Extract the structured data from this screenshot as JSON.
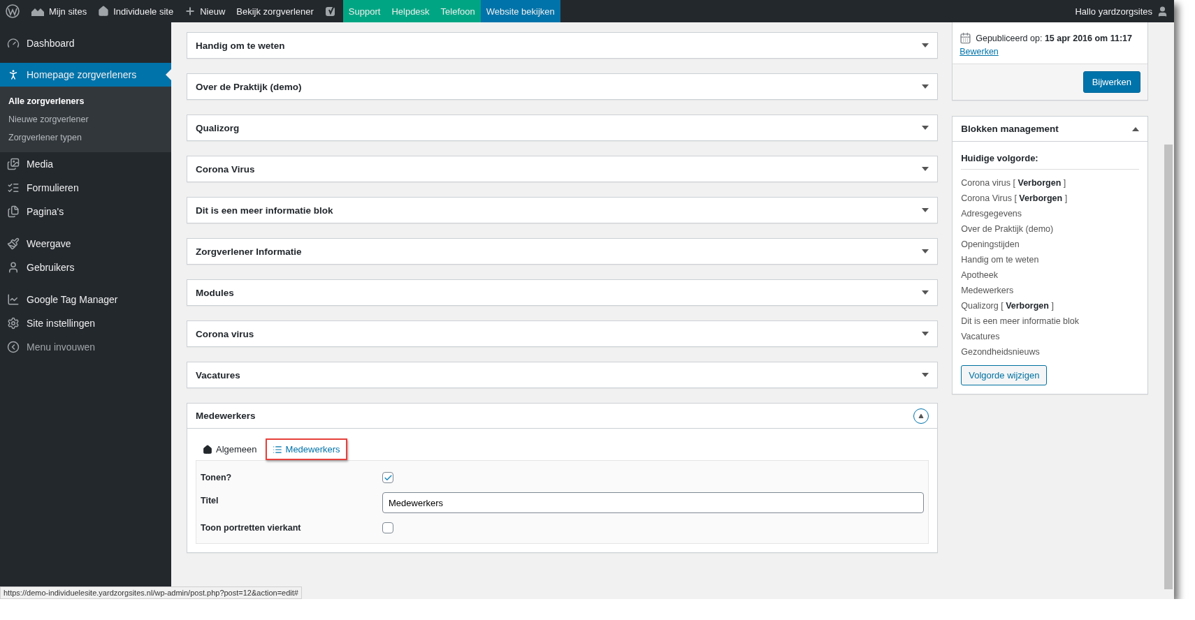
{
  "admin_bar": {
    "left": [
      {
        "kind": "logo"
      },
      {
        "kind": "sites",
        "label": "Mijn sites"
      },
      {
        "kind": "home",
        "label": "Individuele site"
      },
      {
        "kind": "plus",
        "label": "Nieuw"
      },
      {
        "kind": "text",
        "label": "Bekijk zorgverlener"
      },
      {
        "kind": "yoast"
      },
      {
        "kind": "green",
        "label": "Support"
      },
      {
        "kind": "green",
        "label": "Helpdesk"
      },
      {
        "kind": "green",
        "label": "Telefoon"
      },
      {
        "kind": "blue",
        "label": "Website bekijken"
      }
    ],
    "greeting": "Hallo yardzorgsites"
  },
  "sidebar": {
    "items": [
      {
        "label": "Dashboard",
        "selected": false
      },
      {
        "label": "Homepage zorgverleners",
        "selected": true,
        "children": [
          {
            "label": "Alle zorgverleners",
            "selected": true
          },
          {
            "label": "Nieuwe zorgverlener",
            "selected": false
          },
          {
            "label": "Zorgverlener typen",
            "selected": false
          }
        ]
      },
      {
        "label": "Media",
        "selected": false
      },
      {
        "label": "Formulieren",
        "selected": false
      },
      {
        "label": "Pagina's",
        "selected": false
      },
      {
        "label": "Weergave",
        "selected": false
      },
      {
        "label": "Gebruikers",
        "selected": false
      },
      {
        "label": "Google Tag Manager",
        "selected": false
      },
      {
        "label": "Site instellingen",
        "selected": false
      },
      {
        "label": "Menu invouwen",
        "selected": false
      }
    ]
  },
  "blocks": [
    {
      "title": "Handig om te weten",
      "expanded": false
    },
    {
      "title": "Over de Praktijk (demo)",
      "expanded": false
    },
    {
      "title": "Qualizorg",
      "expanded": false
    },
    {
      "title": "Corona Virus",
      "expanded": false
    },
    {
      "title": "Dit is een meer informatie blok",
      "expanded": false
    },
    {
      "title": "Zorgverlener Informatie",
      "expanded": false
    },
    {
      "title": "Modules",
      "expanded": false
    },
    {
      "title": "Corona virus",
      "expanded": false
    },
    {
      "title": "Vacatures",
      "expanded": false
    },
    {
      "title": "Medewerkers",
      "expanded": true,
      "tabs": [
        {
          "label": "Algemeen",
          "selected": false,
          "highlighted": false
        },
        {
          "label": "Medewerkers",
          "selected": true,
          "highlighted": true
        }
      ],
      "fields": [
        {
          "kind": "checkbox",
          "label": "Tonen?",
          "checked": true
        },
        {
          "kind": "text",
          "label": "Titel",
          "value": "Medewerkers"
        },
        {
          "kind": "checkbox",
          "label": "Toon portretten vierkant",
          "checked": false
        }
      ]
    }
  ],
  "publish": {
    "date_label": "Gepubliceerd op:",
    "date": "15 apr 2016 om 11:17",
    "edit_link": "Bewerken",
    "button": "Bijwerken"
  },
  "order_box": {
    "title": "Blokken management",
    "expanded": true,
    "heading": "Huidige volgorde:",
    "items": [
      "Corona virus [ **Verborgen** ]",
      "Corona Virus [ **Verborgen** ]",
      "Adresgegevens",
      "Over de Praktijk (demo)",
      "Openingstijden",
      "Handig om te weten",
      "Apotheek",
      "Medewerkers",
      "Qualizorg [ **Verborgen** ]",
      "Dit is een meer informatie blok",
      "Vacatures",
      "Gezondheidsnieuws"
    ],
    "button": "Volgorde wijzigen"
  },
  "status_url": "https://demo-individuelesite.yardzorgsites.nl/wp-admin/post.php?post=12&action=edit#"
}
